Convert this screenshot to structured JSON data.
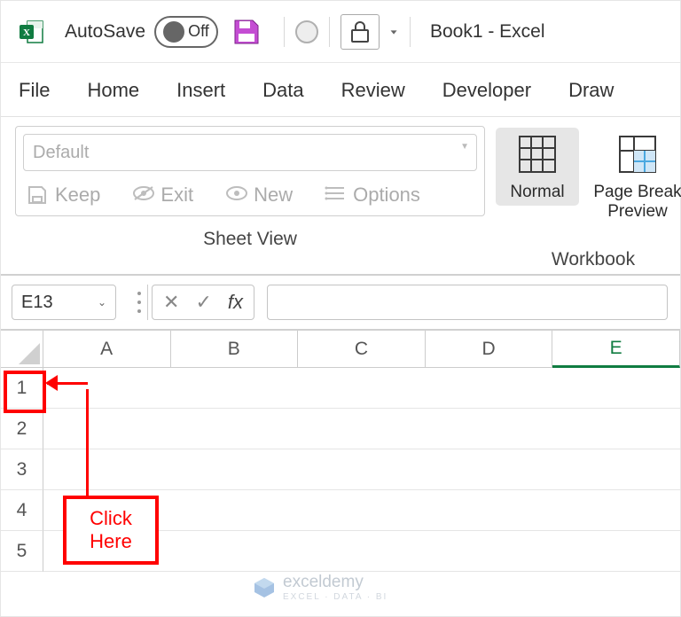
{
  "titlebar": {
    "autosave_label": "AutoSave",
    "autosave_state": "Off",
    "doc_title": "Book1  -  Excel"
  },
  "menu": {
    "items": [
      "File",
      "Home",
      "Insert",
      "Data",
      "Review",
      "Developer",
      "Draw"
    ]
  },
  "ribbon": {
    "sheet_view": {
      "dropdown_value": "Default",
      "keep": "Keep",
      "exit": "Exit",
      "new": "New",
      "options": "Options",
      "group_label": "Sheet View"
    },
    "workbook": {
      "normal": "Normal",
      "page_break": "Page Break Preview",
      "group_label": "Workbook"
    }
  },
  "formula_bar": {
    "name_box": "E13",
    "fx_label": "fx",
    "formula_value": ""
  },
  "grid": {
    "columns": [
      "A",
      "B",
      "C",
      "D",
      "E"
    ],
    "active_column": "E",
    "rows": [
      "1",
      "2",
      "3",
      "4",
      "5"
    ]
  },
  "annotation": {
    "tip": "Click Here"
  },
  "watermark": {
    "brand": "exceldemy",
    "tagline": "EXCEL · DATA · BI"
  }
}
